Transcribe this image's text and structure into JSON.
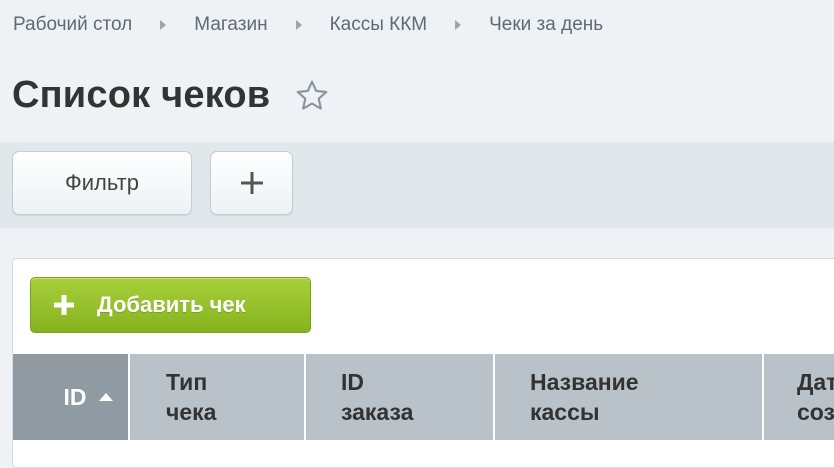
{
  "breadcrumb": [
    "Рабочий стол",
    "Магазин",
    "Кассы ККМ",
    "Чеки за день"
  ],
  "page": {
    "title": "Список чеков"
  },
  "toolbar": {
    "filter_label": "Фильтр"
  },
  "grid": {
    "add_label": "Добавить чек",
    "columns": [
      {
        "line1": "ID",
        "line2": ""
      },
      {
        "line1": "Тип",
        "line2": "чека"
      },
      {
        "line1": "ID",
        "line2": "заказа"
      },
      {
        "line1": "Название",
        "line2": "кассы"
      },
      {
        "line1": "Дат",
        "line2": "соз"
      }
    ]
  },
  "colors": {
    "accent_green": "#8dbb24",
    "header_bg": "#b8c2c8",
    "sorted_header_bg": "#8f9aa3"
  },
  "icons": {
    "favorite": "star-icon",
    "add": "plus-icon"
  }
}
